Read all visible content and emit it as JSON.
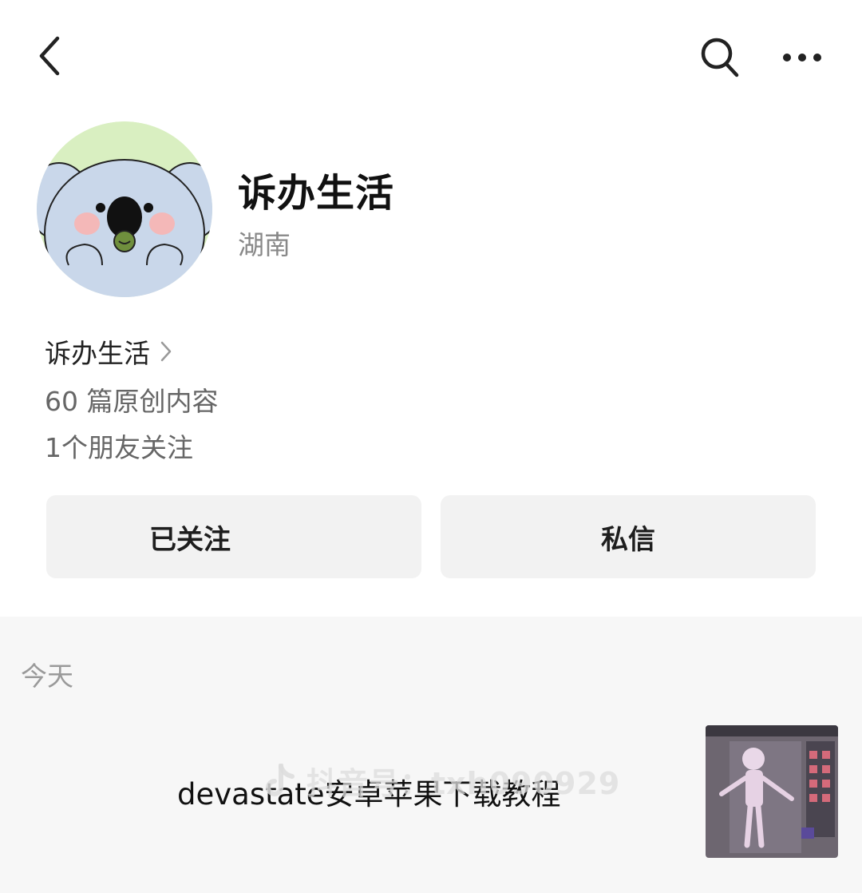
{
  "icons": {
    "back": "chevron-left-icon",
    "search": "search-icon",
    "more": "more-horizontal-icon",
    "link_arrow": "chevron-right-icon"
  },
  "profile": {
    "name": "诉办生活",
    "region": "湖南"
  },
  "info": {
    "account_link": "诉办生活",
    "original_count": "60 篇原创内容",
    "friends_following": "1个朋友关注"
  },
  "actions": {
    "follow_label": "已关注",
    "message_label": "私信"
  },
  "feed": {
    "date_label": "今天",
    "articles": [
      {
        "title": "devastate安卓苹果下载教程"
      }
    ]
  },
  "watermark": {
    "text": "抖音号：txh090929"
  },
  "colors": {
    "background": "#ffffff",
    "button_bg": "#f2f2f2",
    "feed_bg": "#f7f7f7",
    "muted_text": "#888888",
    "avatar_bg": "#d9efc1",
    "koala": "#c9d7ea"
  }
}
